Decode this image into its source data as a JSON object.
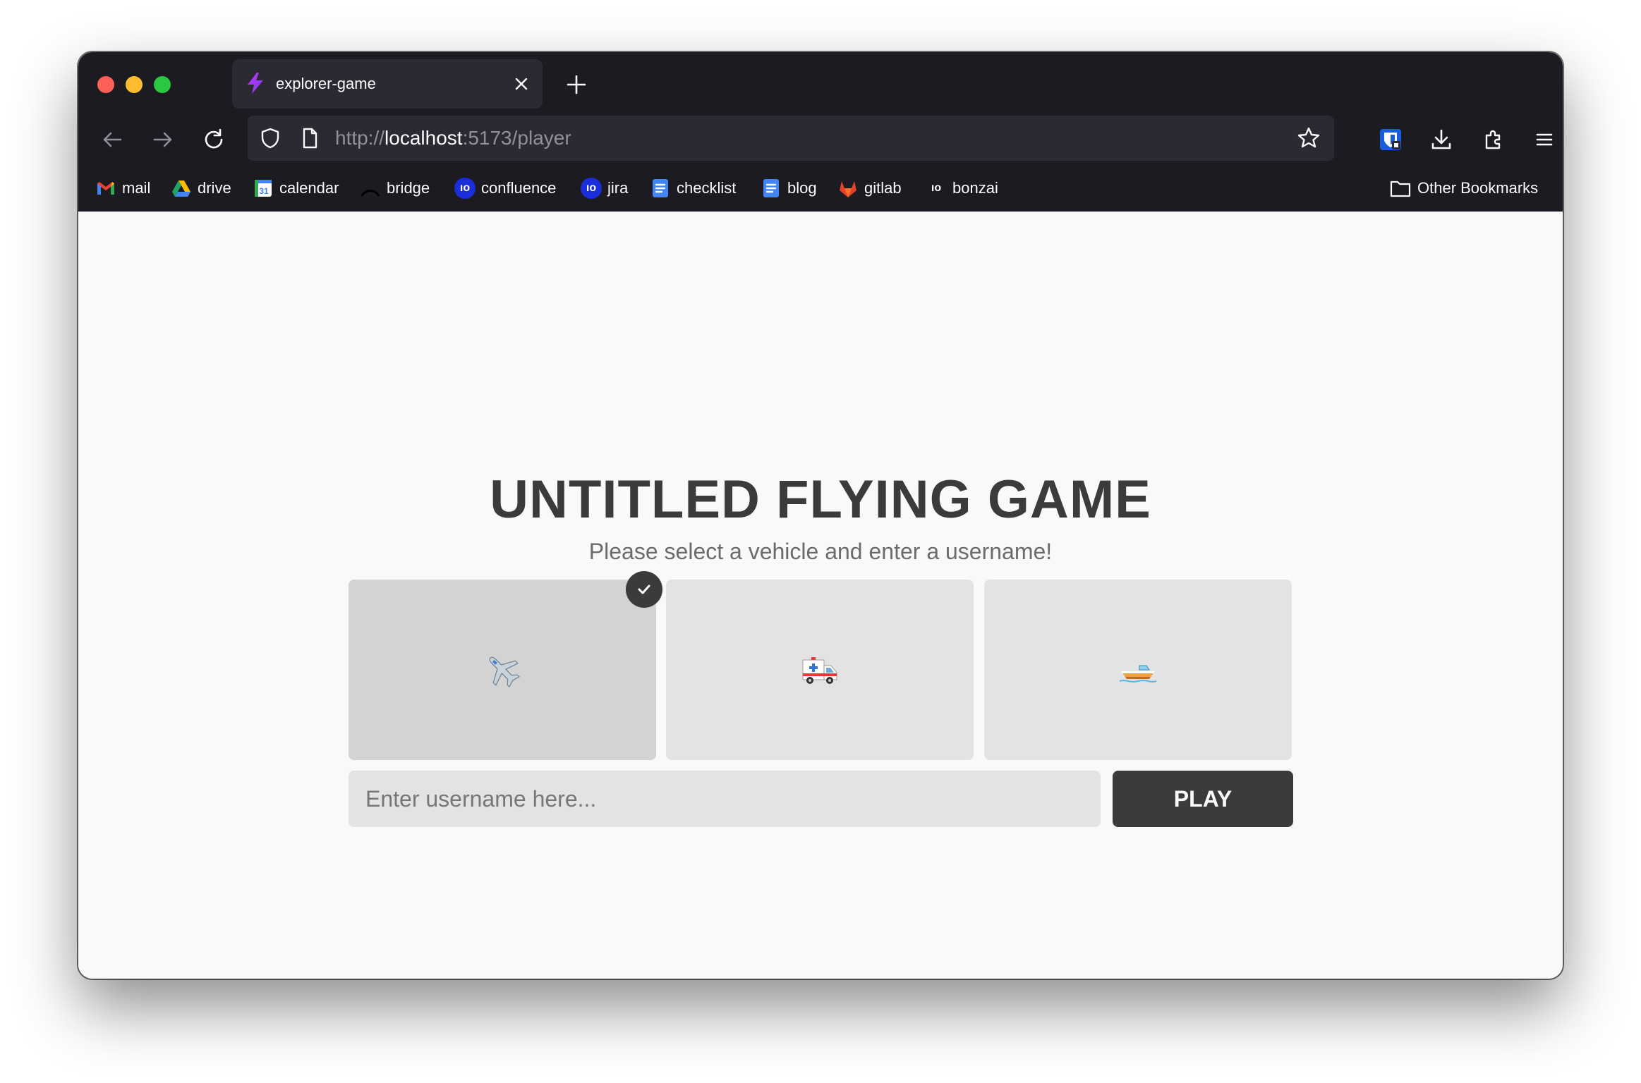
{
  "browser": {
    "tab_title": "explorer-game",
    "url_scheme": "http://",
    "url_host": "localhost",
    "url_rest": ":5173/player"
  },
  "bookmarks": [
    {
      "label": "mail",
      "icon": "gmail-icon",
      "color": "#ea4335"
    },
    {
      "label": "drive",
      "icon": "drive-icon",
      "color": "#1fa463"
    },
    {
      "label": "calendar",
      "icon": "calendar-icon",
      "color": "#4285f4"
    },
    {
      "label": "bridge",
      "icon": "bridge-icon",
      "color": "#111111"
    },
    {
      "label": "confluence",
      "icon": "confluence-icon",
      "color": "#1a2edb"
    },
    {
      "label": "jira",
      "icon": "jira-icon",
      "color": "#1a2edb"
    },
    {
      "label": "checklist",
      "icon": "docs-icon",
      "color": "#4285f4"
    },
    {
      "label": "blog",
      "icon": "docs-icon",
      "color": "#4285f4"
    },
    {
      "label": "gitlab",
      "icon": "gitlab-icon",
      "color": "#e24329"
    },
    {
      "label": "bonzai",
      "icon": "bonzai-icon",
      "color": "#1c1b22"
    }
  ],
  "other_bookmarks": "Other Bookmarks",
  "game": {
    "title": "UNTITLED FLYING GAME",
    "subtitle": "Please select a vehicle and enter a username!",
    "vehicles": [
      {
        "name": "airplane",
        "emoji": "✈️",
        "selected": true
      },
      {
        "name": "ambulance",
        "emoji": "🚑",
        "selected": false
      },
      {
        "name": "speedboat",
        "emoji": "🚤",
        "selected": false
      }
    ],
    "username_placeholder": "Enter username here...",
    "username_value": "",
    "play_label": "PLAY"
  },
  "colors": {
    "dark": "#3b3b3b",
    "card": "#e3e3e3",
    "card_selected": "#d3d3d3",
    "background": "#f8f9f9"
  }
}
